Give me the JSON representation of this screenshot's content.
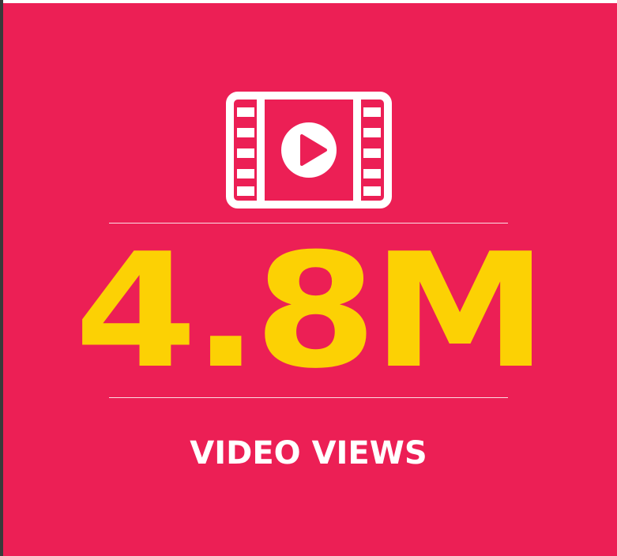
{
  "card": {
    "background_color": "#ec1f55",
    "icon": "film-play-icon",
    "value": "4.8M",
    "value_color": "#fcd104",
    "label": "VIDEO VIEWS",
    "label_color": "#ffffff"
  }
}
